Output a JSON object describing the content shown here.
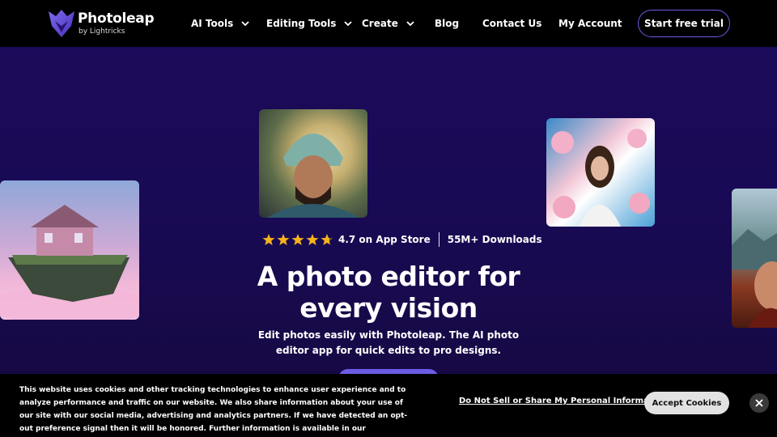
{
  "header": {
    "logo": {
      "name": "Photoleap",
      "sub": "by Lightricks",
      "icon": "photoleap-logo-icon"
    },
    "nav": [
      {
        "label": "AI Tools",
        "dropdown": true
      },
      {
        "label": "Editing Tools",
        "dropdown": true
      },
      {
        "label": "Create",
        "dropdown": true
      },
      {
        "label": "Blog",
        "dropdown": false
      },
      {
        "label": "Contact Us",
        "dropdown": false
      },
      {
        "label": "My Account",
        "dropdown": false
      }
    ],
    "cta": "Start free trial"
  },
  "hero": {
    "rating": {
      "stars": 4.7,
      "store_text": "4.7 on App Store",
      "downloads": "55M+ Downloads"
    },
    "headline_line1": "A photo editor for",
    "headline_line2": "every vision",
    "subtext": "Edit photos easily with Photoleap. The AI photo editor app for quick edits to pro designs."
  },
  "cookie_banner": {
    "text": "This website uses cookies and other tracking technologies to enhance user experience and to analyze performance and traffic on our website. We also share information about your use of our site with our social media, advertising and analytics partners. If we have detected an opt-out preference signal then it will be honored. Further information is available in our",
    "do_not_sell": "Do Not Sell or Share My Personal Information",
    "accept": "Accept Cookies"
  },
  "colors": {
    "accent": "#6b5ce6",
    "background": "#1c0a5a",
    "star": "#f5b21b"
  }
}
